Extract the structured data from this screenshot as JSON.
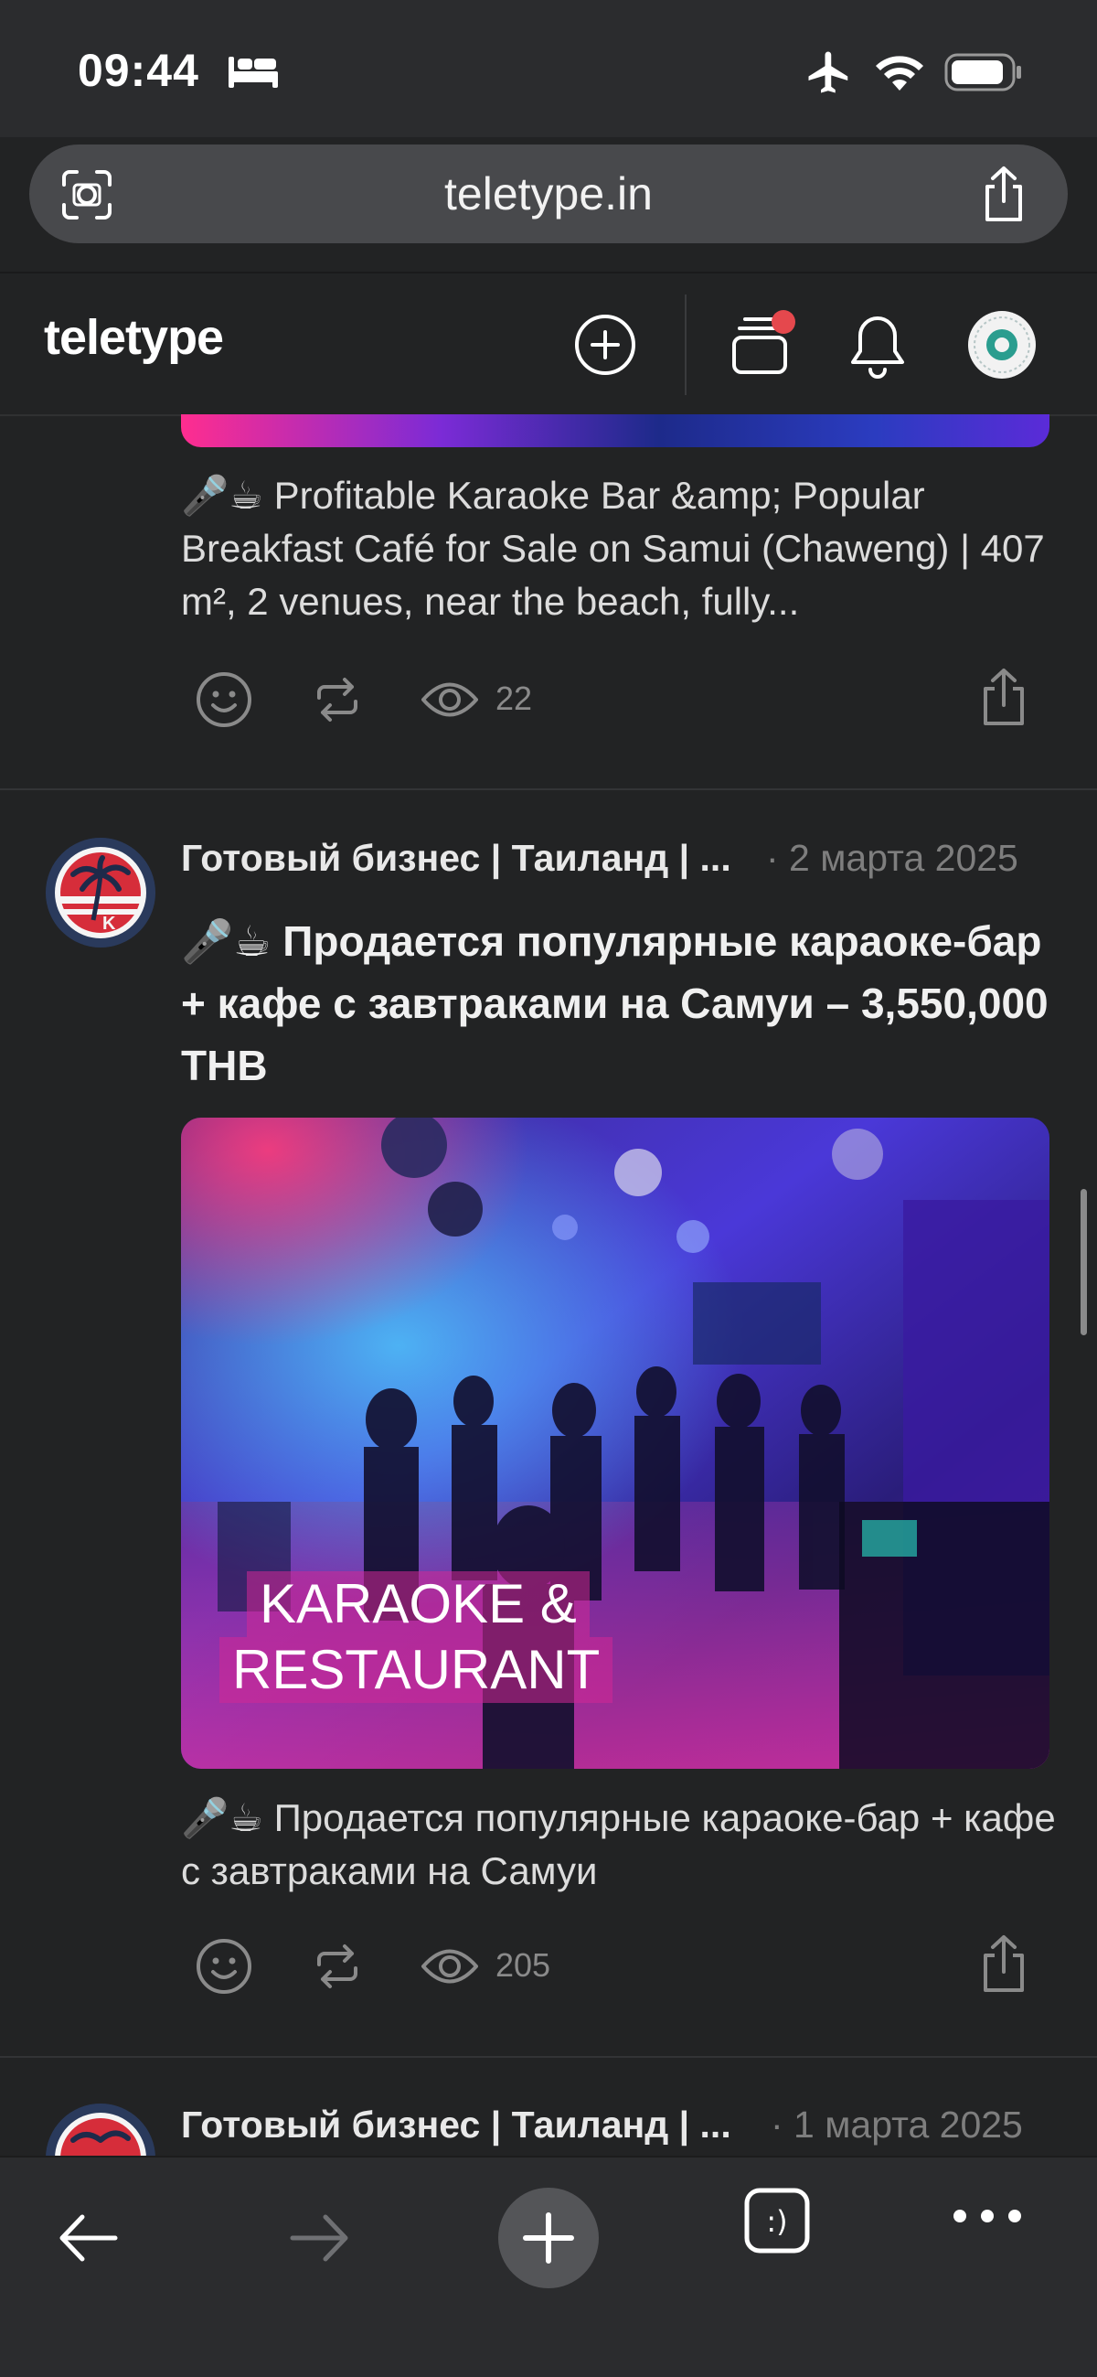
{
  "status_bar": {
    "time": "09:44"
  },
  "browser": {
    "url": "teletype.in"
  },
  "site": {
    "logo": "teletype"
  },
  "posts": [
    {
      "excerpt": "🎤☕ Profitable Karaoke Bar &amp; Popular Breakfast Café for Sale on Samui (Chaweng) | 407 m², 2 venues, near the beach, fully...",
      "views": "22"
    },
    {
      "author": "Готовый бизнес | Таиланд | ...",
      "date": "· 2 марта 2025",
      "title": "🎤☕ Продается популярные караоке-бар + кафе с завтраками на Самуи – 3,550,000 THB",
      "image_overlay_line1": "KARAOKE &",
      "image_overlay_line2": "RESTAURANT",
      "excerpt": "🎤☕ Продается популярные караоке-бар + кафе с завтраками на Самуи",
      "views": "205"
    },
    {
      "author": "Готовый бизнес | Таиланд | ...",
      "date": "· 1 марта 2025"
    }
  ],
  "colors": {
    "notification_dot": "#e5484d",
    "background": "#222324",
    "accent_avatar": "#2a9d8f"
  },
  "icons": [
    "bed-icon",
    "airplane-icon",
    "wifi-icon",
    "battery-icon",
    "scan-icon",
    "share-icon",
    "add-icon",
    "feed-icon",
    "bell-icon",
    "reaction-icon",
    "repost-icon",
    "views-icon",
    "back-icon",
    "forward-icon",
    "tabs-icon",
    "more-icon"
  ]
}
